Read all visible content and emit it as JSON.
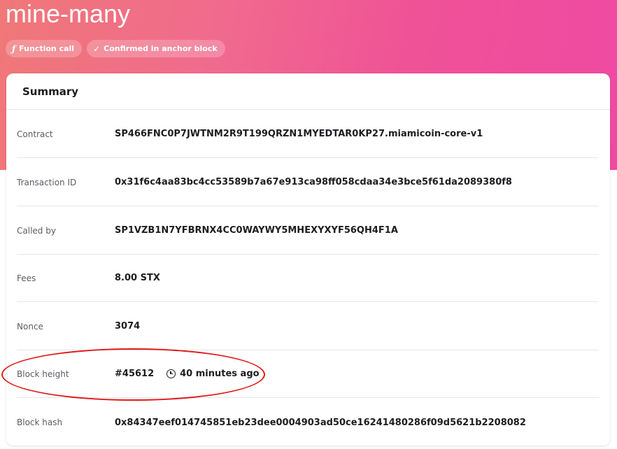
{
  "header": {
    "title": "mine-many",
    "tags": [
      {
        "icon": "ƒ",
        "label": "Function call"
      },
      {
        "icon": "✓",
        "label": "Confirmed in anchor block"
      }
    ]
  },
  "summary": {
    "title": "Summary",
    "rows": [
      {
        "label": "Contract",
        "value": "SP466FNC0P7JWTNM2R9T199QRZN1MYEDTAR0KP27.miamicoin-core-v1"
      },
      {
        "label": "Transaction ID",
        "value": "0x31f6c4aa83bc4cc53589b7a67e913ca98ff058cdaa34e3bce5f61da2089380f8"
      },
      {
        "label": "Called by",
        "value": "SP1VZB1N7YFBRNX4CC0WAYWY5MHEXYXYF56QH4F1A"
      },
      {
        "label": "Fees",
        "value": "8.00 STX"
      },
      {
        "label": "Nonce",
        "value": "3074"
      },
      {
        "label": "Block height",
        "value": "#45612",
        "time": "40 minutes ago"
      },
      {
        "label": "Block hash",
        "value": "0x84347eef014745851eb23dee0004903ad50ce16241480286f09d5621b2208082"
      }
    ]
  },
  "colors": {
    "hero_start": "#f07878",
    "hero_end": "#ef4aa3",
    "annotation": "#e11a1a"
  }
}
